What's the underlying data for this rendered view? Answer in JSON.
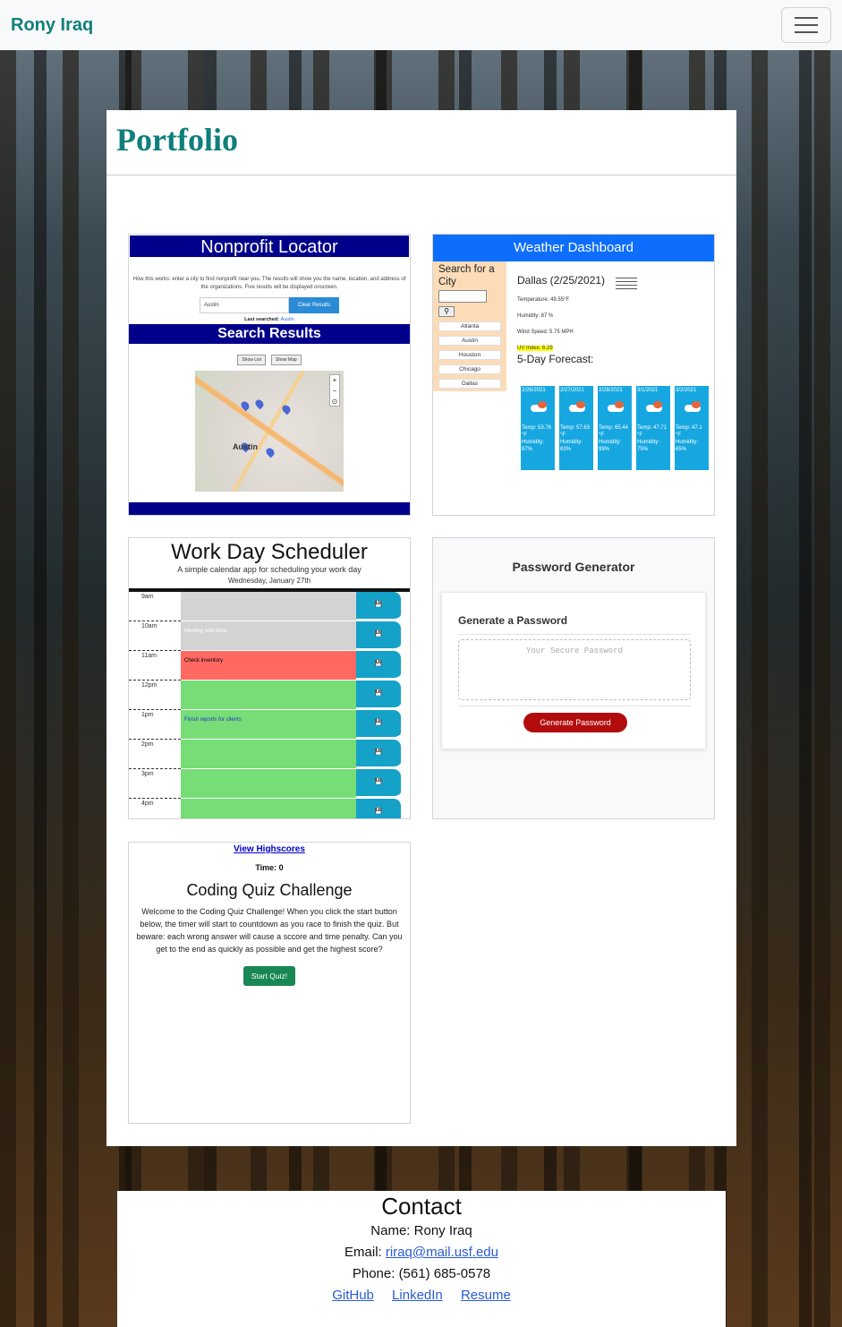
{
  "navbar": {
    "brand": "Rony Iraq",
    "menu_icon": "hamburger-icon"
  },
  "portfolio": {
    "title": "Portfolio",
    "projects": [
      {
        "name": "Nonprofit Locator",
        "description": "How this works: enter a city to find nonprofit near you. The results will show you the name, location, and address of the organizations. Five results will be displayed onscreen.",
        "input_value": "Austin",
        "button": "Clear Results",
        "last_searched_label": "Last searched:",
        "last_searched_value": "Austin",
        "results_title": "Search Results",
        "show_list": "Show List",
        "show_map": "Show Map",
        "map_city": "Austin"
      },
      {
        "name": "Weather Dashboard",
        "search_label": "Search for a City",
        "cities": [
          "Atlanta",
          "Austin",
          "Houston",
          "Chicago",
          "Dallas"
        ],
        "current_city": "Dallas (2/25/2021)",
        "temperature": "Temperature: 49.55°F",
        "humidity": "Humidity: 87 %",
        "wind": "Wind Speed: 5.75 MPH",
        "uv": "UV Index: 6.29",
        "forecast_title": "5-Day Forecast:",
        "forecast": [
          {
            "date": "2/26/2021",
            "temp": "Temp: 53.76 °F",
            "humidity": "Humidity: 87%"
          },
          {
            "date": "2/27/2021",
            "temp": "Temp: 57.63 °F",
            "humidity": "Humidity: 83%"
          },
          {
            "date": "2/28/2021",
            "temp": "Temp: 65.44 °F",
            "humidity": "Humidity: 99%"
          },
          {
            "date": "3/1/2021",
            "temp": "Temp: 47.71 °F",
            "humidity": "Humidity: 75%"
          },
          {
            "date": "3/2/2021",
            "temp": "Temp: 47.1 °F",
            "humidity": "Humidity: 65%"
          }
        ]
      },
      {
        "name": "Work Day Scheduler",
        "subtitle": "A simple calendar app for scheduling your work day",
        "date": "Wednesday, January 27th",
        "hours": [
          {
            "hour": "9am",
            "text": "",
            "state": "past"
          },
          {
            "hour": "10am",
            "text": "Meeting with boss",
            "state": "past"
          },
          {
            "hour": "11am",
            "text": "Check inventory",
            "state": "present"
          },
          {
            "hour": "12pm",
            "text": "",
            "state": "future"
          },
          {
            "hour": "1pm",
            "text": "Finish reports for clients",
            "state": "future"
          },
          {
            "hour": "2pm",
            "text": "",
            "state": "future"
          },
          {
            "hour": "3pm",
            "text": "",
            "state": "future"
          },
          {
            "hour": "4pm",
            "text": "",
            "state": "future"
          }
        ],
        "save_icon": "save-icon"
      },
      {
        "name": "Password Generator",
        "card_title": "Generate a Password",
        "placeholder": "Your Secure Password",
        "button": "Generate Password"
      },
      {
        "name": "Coding Quiz Challenge",
        "highscores": "View Highscores",
        "time": "Time: 0",
        "description": "Welcome to the Coding Quiz Challenge! When you click the start button below, the timer will start to countdown as you race to finish the quiz. But beware: each wrong answer will cause a sccore and time penalty. Can you get to the end as quickly as possible and get the highest score?",
        "button": "Start Quiz!"
      }
    ]
  },
  "contact": {
    "title": "Contact",
    "name_label": "Name: ",
    "name": "Rony Iraq",
    "email_label": "Email: ",
    "email": "riraq@mail.usf.edu",
    "phone_label": "Phone: ",
    "phone": "(561) 685-0578",
    "links": [
      "GitHub",
      "LinkedIn",
      "Resume"
    ]
  }
}
